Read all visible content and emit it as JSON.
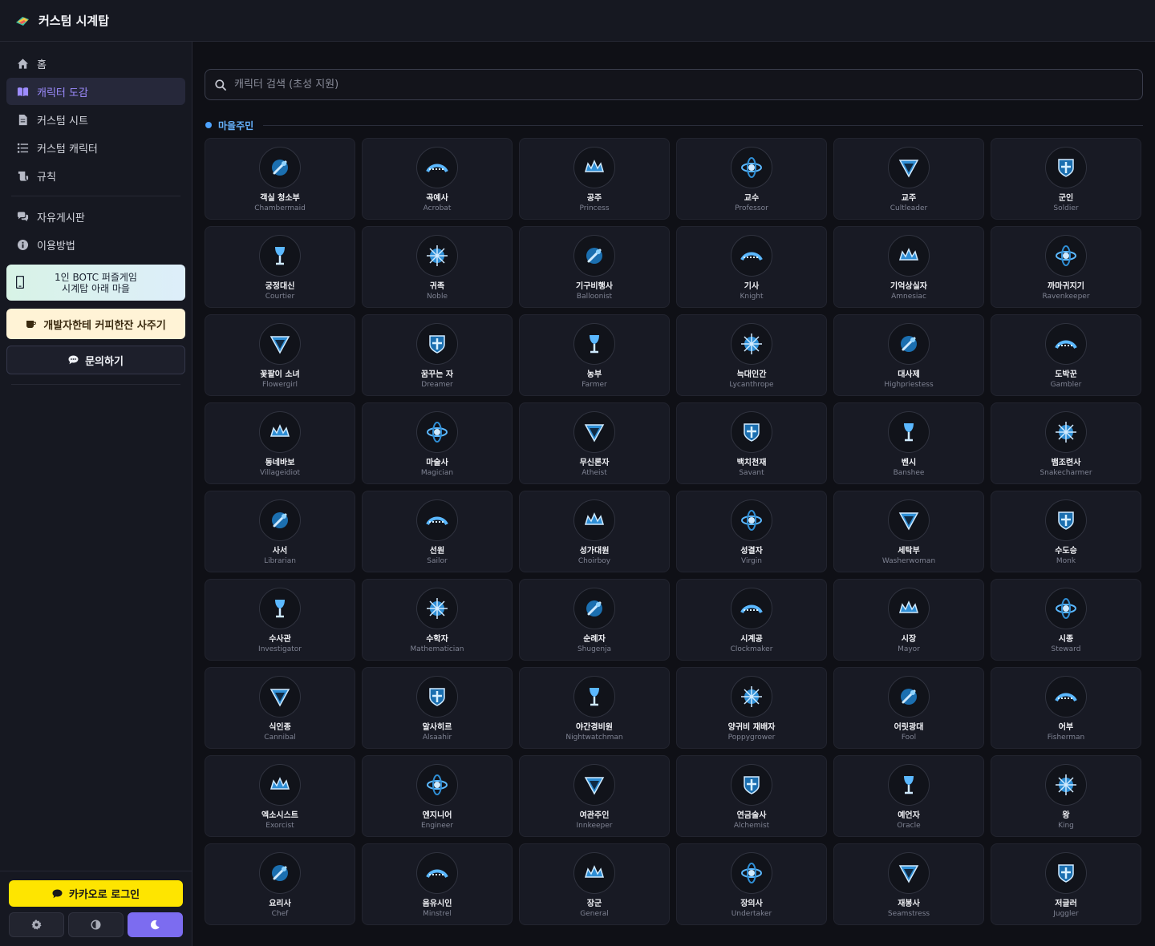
{
  "app": {
    "title": "커스텀 시계탑"
  },
  "sidebar": {
    "nav": [
      {
        "label": "홈",
        "icon": "home-icon"
      },
      {
        "label": "캐릭터 도감",
        "icon": "book-icon",
        "active": true
      },
      {
        "label": "커스텀 시트",
        "icon": "document-icon"
      },
      {
        "label": "커스텀 캐릭터",
        "icon": "list-icon"
      },
      {
        "label": "규칙",
        "icon": "scroll-icon"
      }
    ],
    "nav2": [
      {
        "label": "자유게시판",
        "icon": "comments-icon"
      },
      {
        "label": "이용방법",
        "icon": "info-icon"
      }
    ],
    "promo": {
      "line1": "1인 BOTC 퍼즐게임",
      "line2": "시계탑 아래 마을"
    },
    "coffee_label": "개발자한테 커피한잔 사주기",
    "contact_label": "문의하기",
    "kakao_label": "카카오로 로그인",
    "theme_buttons": [
      "gear-icon",
      "contrast-icon",
      "moon-icon"
    ],
    "theme_active": "moon-icon"
  },
  "search": {
    "placeholder": "캐릭터 검색 (초성 지원)"
  },
  "section": {
    "label": "마을주민"
  },
  "colors": {
    "accent": "#7c6cf0",
    "section": "#4da3ff",
    "kakao": "#fee500"
  },
  "characters": [
    {
      "kr": "객실 청소부",
      "en": "Chambermaid"
    },
    {
      "kr": "곡예사",
      "en": "Acrobat"
    },
    {
      "kr": "공주",
      "en": "Princess"
    },
    {
      "kr": "교수",
      "en": "Professor"
    },
    {
      "kr": "교주",
      "en": "Cultleader"
    },
    {
      "kr": "군인",
      "en": "Soldier"
    },
    {
      "kr": "궁정대신",
      "en": "Courtier"
    },
    {
      "kr": "귀족",
      "en": "Noble"
    },
    {
      "kr": "기구비행사",
      "en": "Balloonist"
    },
    {
      "kr": "기사",
      "en": "Knight"
    },
    {
      "kr": "기억상실자",
      "en": "Amnesiac"
    },
    {
      "kr": "까마귀지기",
      "en": "Ravenkeeper"
    },
    {
      "kr": "꽃팔이 소녀",
      "en": "Flowergirl"
    },
    {
      "kr": "꿈꾸는 자",
      "en": "Dreamer"
    },
    {
      "kr": "농부",
      "en": "Farmer"
    },
    {
      "kr": "늑대인간",
      "en": "Lycanthrope"
    },
    {
      "kr": "대사제",
      "en": "Highpriestess"
    },
    {
      "kr": "도박꾼",
      "en": "Gambler"
    },
    {
      "kr": "동네바보",
      "en": "Villageidiot"
    },
    {
      "kr": "마술사",
      "en": "Magician"
    },
    {
      "kr": "무신론자",
      "en": "Atheist"
    },
    {
      "kr": "백치천재",
      "en": "Savant"
    },
    {
      "kr": "벤시",
      "en": "Banshee"
    },
    {
      "kr": "뱀조련사",
      "en": "Snakecharmer"
    },
    {
      "kr": "사서",
      "en": "Librarian"
    },
    {
      "kr": "선원",
      "en": "Sailor"
    },
    {
      "kr": "성가대원",
      "en": "Choirboy"
    },
    {
      "kr": "성결자",
      "en": "Virgin"
    },
    {
      "kr": "세탁부",
      "en": "Washerwoman"
    },
    {
      "kr": "수도승",
      "en": "Monk"
    },
    {
      "kr": "수사관",
      "en": "Investigator"
    },
    {
      "kr": "수학자",
      "en": "Mathematician"
    },
    {
      "kr": "순례자",
      "en": "Shugenja"
    },
    {
      "kr": "시계공",
      "en": "Clockmaker"
    },
    {
      "kr": "시장",
      "en": "Mayor"
    },
    {
      "kr": "시종",
      "en": "Steward"
    },
    {
      "kr": "식인종",
      "en": "Cannibal"
    },
    {
      "kr": "알사히르",
      "en": "Alsaahir"
    },
    {
      "kr": "야간경비원",
      "en": "Nightwatchman"
    },
    {
      "kr": "양귀비 재배자",
      "en": "Poppygrower"
    },
    {
      "kr": "어릿광대",
      "en": "Fool"
    },
    {
      "kr": "어부",
      "en": "Fisherman"
    },
    {
      "kr": "엑소시스트",
      "en": "Exorcist"
    },
    {
      "kr": "엔지니어",
      "en": "Engineer"
    },
    {
      "kr": "여관주인",
      "en": "Innkeeper"
    },
    {
      "kr": "연금술사",
      "en": "Alchemist"
    },
    {
      "kr": "예언자",
      "en": "Oracle"
    },
    {
      "kr": "왕",
      "en": "King"
    },
    {
      "kr": "요리사",
      "en": "Chef"
    },
    {
      "kr": "음유시인",
      "en": "Minstrel"
    },
    {
      "kr": "장군",
      "en": "General"
    },
    {
      "kr": "장의사",
      "en": "Undertaker"
    },
    {
      "kr": "재봉사",
      "en": "Seamstress"
    },
    {
      "kr": "저글러",
      "en": "Juggler"
    }
  ]
}
